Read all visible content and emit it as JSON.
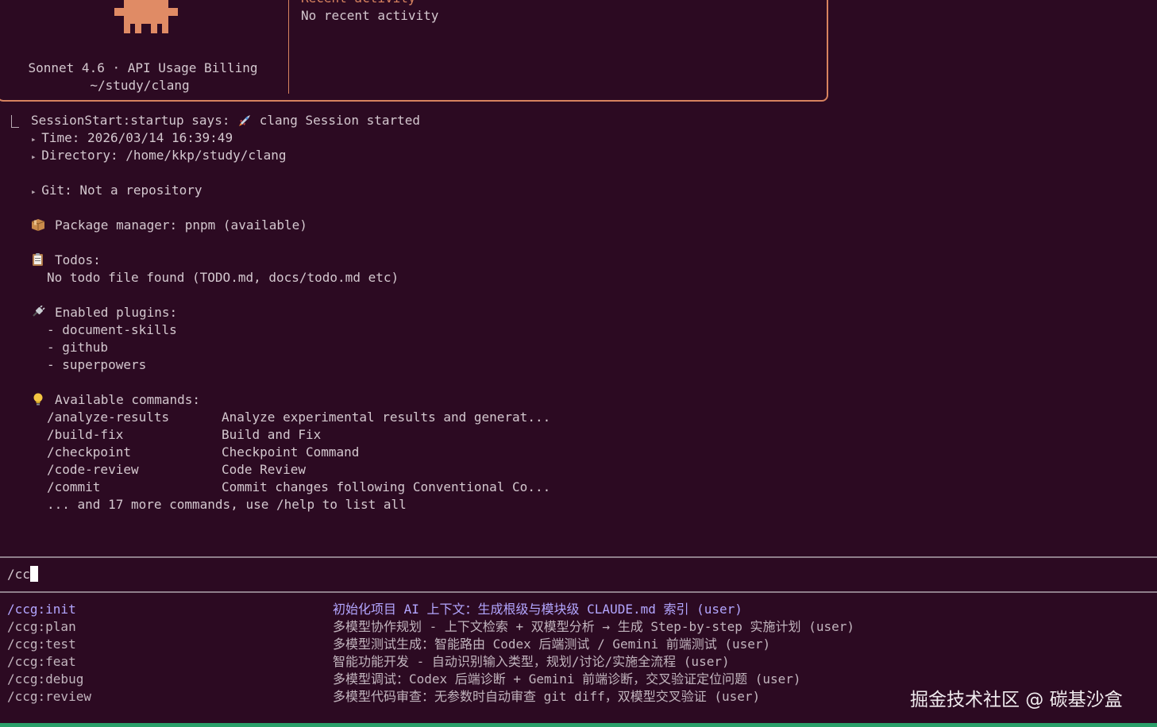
{
  "header": {
    "model_line": "Sonnet 4.6 · API Usage Billing",
    "cwd": "~/study/clang",
    "recent_title": "Recent activity",
    "recent_text": "No recent activity"
  },
  "session": {
    "start_line": "SessionStart:startup says: ",
    "start_msg": " clang Session started",
    "time_label": "Time: 2026/03/14 16:39:49",
    "directory_label": "Directory: /home/kkp/study/clang",
    "git_label": "Git: Not a repository",
    "package_label": "Package manager: pnpm (available)",
    "todos_label": "Todos:",
    "todos_text": "No todo file found (TODO.md, docs/todo.md etc)",
    "plugins_label": "Enabled plugins:",
    "plugins": [
      "- document-skills",
      "- github",
      "- superpowers"
    ],
    "commands_label": "Available commands:",
    "commands": [
      {
        "name": "/analyze-results",
        "desc": "Analyze experimental results and generat..."
      },
      {
        "name": "/build-fix",
        "desc": "Build and Fix"
      },
      {
        "name": "/checkpoint",
        "desc": "Checkpoint Command"
      },
      {
        "name": "/code-review",
        "desc": "Code Review"
      },
      {
        "name": "/commit",
        "desc": "Commit changes following Conventional Co..."
      }
    ],
    "more_text": "... and 17 more commands, use /help to list all"
  },
  "input": {
    "value": "/cc"
  },
  "suggestions": [
    {
      "name": "/ccg:init",
      "desc": "初始化项目 AI 上下文：生成根级与模块级 CLAUDE.md 索引 (user)"
    },
    {
      "name": "/ccg:plan",
      "desc": "多模型协作规划 - 上下文检索 + 双模型分析 → 生成 Step-by-step 实施计划 (user)"
    },
    {
      "name": "/ccg:test",
      "desc": "多模型测试生成：智能路由 Codex 后端测试 / Gemini 前端测试 (user)"
    },
    {
      "name": "/ccg:feat",
      "desc": "智能功能开发 - 自动识别输入类型，规划/讨论/实施全流程 (user)"
    },
    {
      "name": "/ccg:debug",
      "desc": "多模型调试：Codex 后端诊断 + Gemini 前端诊断，交叉验证定位问题 (user)"
    },
    {
      "name": "/ccg:review",
      "desc": "多模型代码审查：无参数时自动审查 git diff，双模型交叉验证 (user)"
    }
  ],
  "watermark": "掘金技术社区 @ 碳基沙盒",
  "colors": {
    "background": "#2c0a22",
    "accent": "#d7835f",
    "selected": "#b3a6ff"
  }
}
